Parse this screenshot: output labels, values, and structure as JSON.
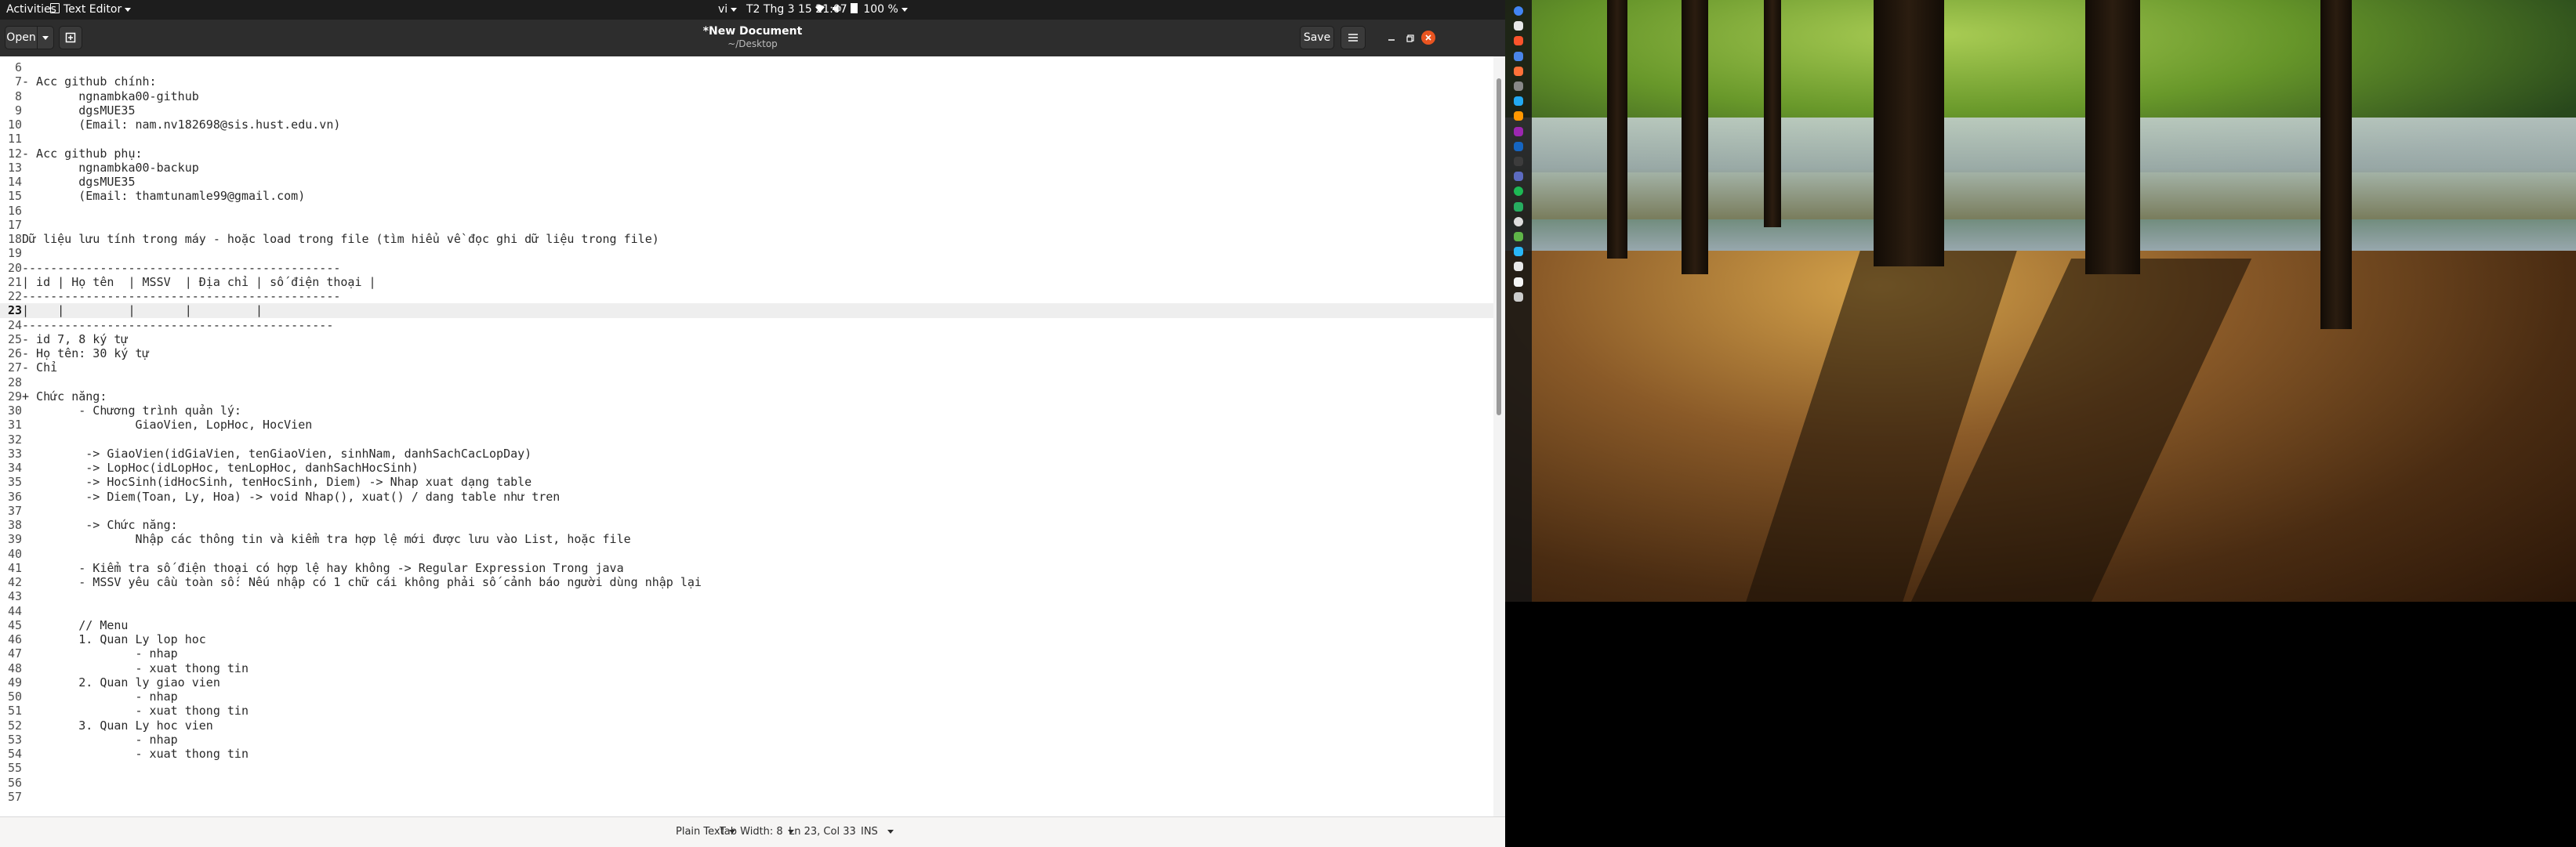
{
  "topbar": {
    "activities": "Activities",
    "app_menu": "Text Editor",
    "input_method": "vi",
    "datetime": "T2 Thg 3 15  21:07",
    "battery": "100 %"
  },
  "window": {
    "title": "*New Document",
    "subtitle": "~/Desktop",
    "open_label": "Open",
    "save_label": "Save"
  },
  "editor": {
    "current_line": 23,
    "lines": [
      {
        "n": "6",
        "t": ""
      },
      {
        "n": "7",
        "t": "- Acc github chính:"
      },
      {
        "n": "8",
        "t": "        ngnambka00-github"
      },
      {
        "n": "9",
        "t": "        dgsMUE35"
      },
      {
        "n": "10",
        "t": "        (Email: nam.nv182698@sis.hust.edu.vn)"
      },
      {
        "n": "11",
        "t": ""
      },
      {
        "n": "12",
        "t": "- Acc github phụ:"
      },
      {
        "n": "13",
        "t": "        ngnambka00-backup"
      },
      {
        "n": "14",
        "t": "        dgsMUE35"
      },
      {
        "n": "15",
        "t": "        (Email: thamtunamle99@gmail.com)"
      },
      {
        "n": "16",
        "t": ""
      },
      {
        "n": "17",
        "t": ""
      },
      {
        "n": "18",
        "t": "Dữ liệu lưu tính trong máy - hoặc load trong file (tìm hiểu về đọc ghi dữ liệu trong file)"
      },
      {
        "n": "19",
        "t": ""
      },
      {
        "n": "20",
        "t": "---------------------------------------------"
      },
      {
        "n": "21",
        "t": "| id | Họ tên  | MSSV  | Địa chỉ | số điện thoại |"
      },
      {
        "n": "22",
        "t": "---------------------------------------------"
      },
      {
        "n": "23",
        "t": "|    |         |       |         |"
      },
      {
        "n": "24",
        "t": "--------------------------------------------"
      },
      {
        "n": "25",
        "t": "- id 7, 8 ký tự"
      },
      {
        "n": "26",
        "t": "- Họ tên: 30 ký tự"
      },
      {
        "n": "27",
        "t": "- Chỉ"
      },
      {
        "n": "28",
        "t": ""
      },
      {
        "n": "29",
        "t": "+ Chức năng:"
      },
      {
        "n": "30",
        "t": "        - Chương trình quản lý:"
      },
      {
        "n": "31",
        "t": "                GiaoVien, LopHoc, HocVien"
      },
      {
        "n": "32",
        "t": ""
      },
      {
        "n": "33",
        "t": "         -> GiaoVien(idGiaVien, tenGiaoVien, sinhNam, danhSachCacLopDay)"
      },
      {
        "n": "34",
        "t": "         -> LopHoc(idLopHoc, tenLopHoc, danhSachHocSinh)"
      },
      {
        "n": "35",
        "t": "         -> HocSinh(idHocSinh, tenHocSinh, Diem) -> Nhap xuat dạng table"
      },
      {
        "n": "36",
        "t": "         -> Diem(Toan, Ly, Hoa) -> void Nhap(), xuat() / dang table như tren"
      },
      {
        "n": "37",
        "t": ""
      },
      {
        "n": "38",
        "t": "         -> Chức năng:"
      },
      {
        "n": "39",
        "t": "                Nhập các thông tin và kiểm tra hợp lệ mới được lưu vào List, hoặc file"
      },
      {
        "n": "40",
        "t": ""
      },
      {
        "n": "41",
        "t": "        - Kiểm tra số điện thoại có hợp lệ hay không -> Regular Expression Trong java"
      },
      {
        "n": "42",
        "t": "        - MSSV yêu cầu toàn số: Nếu nhập có 1 chữ cái không phải số cảnh báo người dùng nhập lại"
      },
      {
        "n": "43",
        "t": ""
      },
      {
        "n": "44",
        "t": ""
      },
      {
        "n": "45",
        "t": "        // Menu"
      },
      {
        "n": "46",
        "t": "        1. Quan Ly lop hoc"
      },
      {
        "n": "47",
        "t": "                - nhap"
      },
      {
        "n": "48",
        "t": "                - xuat thong tin"
      },
      {
        "n": "49",
        "t": "        2. Quan ly giao vien"
      },
      {
        "n": "50",
        "t": "                - nhap"
      },
      {
        "n": "51",
        "t": "                - xuat thong tin"
      },
      {
        "n": "52",
        "t": "        3. Quan Ly hoc vien"
      },
      {
        "n": "53",
        "t": "                - nhap"
      },
      {
        "n": "54",
        "t": "                - xuat thong tin"
      },
      {
        "n": "55",
        "t": ""
      },
      {
        "n": "56",
        "t": ""
      },
      {
        "n": "57",
        "t": ""
      }
    ]
  },
  "statusbar": {
    "language": "Plain Text",
    "tab_width": "Tab Width: 8",
    "position": "Ln 23, Col 33",
    "mode": "INS"
  },
  "colors": {
    "topbar_bg": "#1d1d1d",
    "headerbar_bg": "#2d2d2d",
    "close_button": "#e95420",
    "editor_bg": "#ffffff",
    "current_line_bg": "#eeeeee"
  },
  "dock": {
    "icons": [
      "chrome-icon",
      "files-icon",
      "brave-icon",
      "docs-icon",
      "firefox-icon",
      "settings-icon",
      "vscode-icon",
      "sublime-icon",
      "app-icon",
      "mail-icon",
      "terminal-icon",
      "app-icon",
      "spotify-icon",
      "xmind-icon",
      "ghost-icon",
      "chat-icon",
      "app-icon",
      "files-icon",
      "text-editor-icon",
      "show-apps-icon"
    ]
  }
}
